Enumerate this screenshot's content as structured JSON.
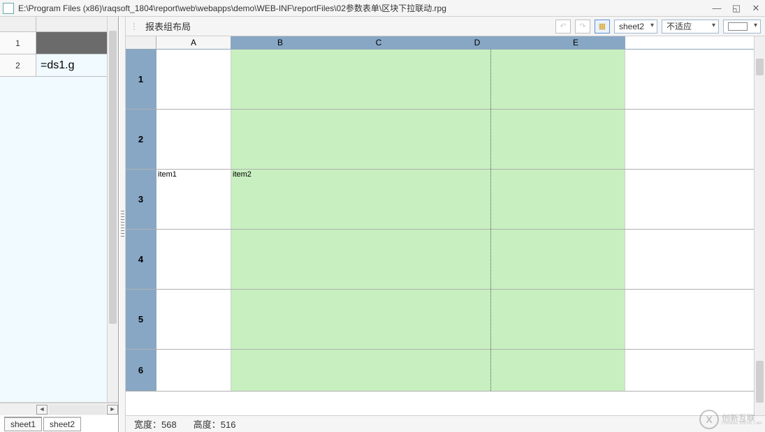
{
  "window": {
    "title": "E:\\Program Files (x86)\\raqsoft_1804\\report\\web\\webapps\\demo\\WEB-INF\\reportFiles\\02参数表单\\区块下拉联动.rpg"
  },
  "left": {
    "rows": [
      {
        "rownum": "1",
        "value": ""
      },
      {
        "rownum": "2",
        "value": "=ds1.g"
      }
    ],
    "tabs": [
      "sheet1",
      "sheet2"
    ],
    "active_tab": 1
  },
  "toolbar": {
    "layout_label": "报表组布局",
    "sheet_combo": "sheet2",
    "fit_combo": "不适应",
    "color": "#ffffff"
  },
  "grid": {
    "columns": [
      "A",
      "B",
      "C",
      "D",
      "E"
    ],
    "rows": [
      "1",
      "2",
      "3",
      "4",
      "5",
      "6"
    ],
    "item_label_1": "item1",
    "item_label_2": "item2"
  },
  "status": {
    "width_label": "宽度：",
    "width_value": "568",
    "height_label": "高度：",
    "height_value": "516"
  },
  "watermark": {
    "logo_text": "X",
    "brand_top": "创新互联",
    "brand_bottom": "CHUANG XIN HU LIAN"
  }
}
